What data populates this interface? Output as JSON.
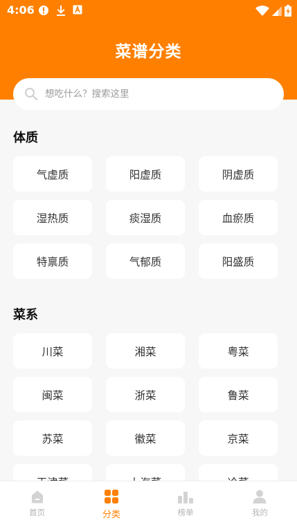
{
  "status_bar": {
    "time": "4:06",
    "icons_left": [
      "alert-circle-icon",
      "download-icon",
      "font-app-icon"
    ],
    "icons_right": [
      "wifi-icon",
      "signal-icon",
      "battery-charging-icon"
    ]
  },
  "header": {
    "title": "菜谱分类",
    "accent_color": "#ff8000"
  },
  "search": {
    "placeholder": "想吃什么？搜索这里",
    "icon": "search-icon"
  },
  "sections": [
    {
      "title": "体质",
      "items": [
        "气虚质",
        "阳虚质",
        "阴虚质",
        "湿热质",
        "痰湿质",
        "血瘀质",
        "特禀质",
        "气郁质",
        "阳盛质"
      ]
    },
    {
      "title": "菜系",
      "items": [
        "川菜",
        "湘菜",
        "粤菜",
        "闽菜",
        "浙菜",
        "鲁菜",
        "苏菜",
        "徽菜",
        "京菜",
        "天津菜",
        "上海菜",
        "冷菜"
      ]
    }
  ],
  "tabbar": {
    "tabs": [
      {
        "label": "首页",
        "icon": "home-icon",
        "active": false
      },
      {
        "label": "分类",
        "icon": "category-grid-icon",
        "active": true
      },
      {
        "label": "榜单",
        "icon": "ranking-icon",
        "active": false
      },
      {
        "label": "我的",
        "icon": "user-icon",
        "active": false
      }
    ]
  }
}
